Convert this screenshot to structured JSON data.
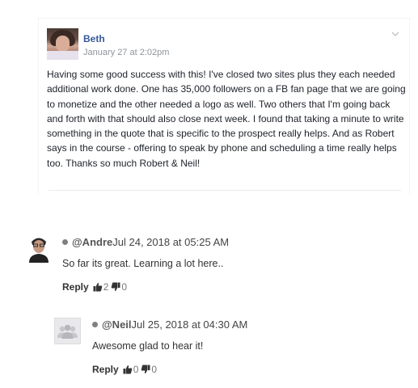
{
  "fb_comment": {
    "author": "Beth",
    "date": "January 27 at 2:02pm",
    "text": "Having some good success with this! I've closed two sites plus they each needed additional work done. One has 35,000 followers on a FB fan page that we are going to monetize and the other needed a logo as well. Two others that I'm going back and forth with that should also close next week. I found that taking a minute to write something in the quote that is specific to the prospect really helps. And as Robert says in the course - offering to speak by phone and scheduling a time really helps too. Thanks so much Robert & Neil!",
    "icons": {
      "menu": "chevron-down-icon",
      "avatar": "user-photo"
    }
  },
  "comments": [
    {
      "user": "@Andre",
      "time": "Jul 24, 2018 at 05:25 AM",
      "text": "So far its great. Learning a lot here..",
      "reply_label": "Reply",
      "likes": "2",
      "dislikes": "0"
    },
    {
      "user": "@Neil",
      "time": "Jul 25, 2018 at 04:30 AM",
      "text": "Awesome glad to hear it!",
      "reply_label": "Reply",
      "likes": "0",
      "dislikes": "0"
    }
  ],
  "colors": {
    "facebook_link": "#365899",
    "meta_grey": "#90949c",
    "status_dot": "#7f7f7f"
  }
}
